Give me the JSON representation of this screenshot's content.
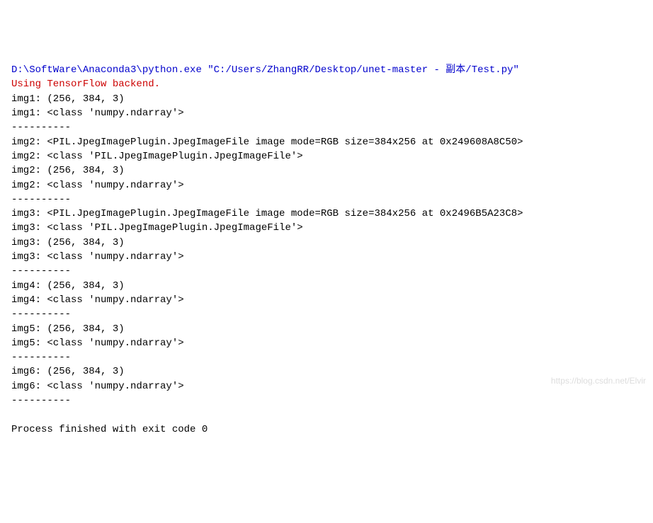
{
  "console": {
    "command": "D:\\SoftWare\\Anaconda3\\python.exe \"C:/Users/ZhangRR/Desktop/unet-master - 副本/Test.py\"",
    "warning": "Using TensorFlow backend.",
    "lines": [
      "img1: (256, 384, 3)",
      "img1: <class 'numpy.ndarray'>",
      "----------",
      "img2: <PIL.JpegImagePlugin.JpegImageFile image mode=RGB size=384x256 at 0x249608A8C50>",
      "img2: <class 'PIL.JpegImagePlugin.JpegImageFile'>",
      "img2: (256, 384, 3)",
      "img2: <class 'numpy.ndarray'>",
      "----------",
      "img3: <PIL.JpegImagePlugin.JpegImageFile image mode=RGB size=384x256 at 0x2496B5A23C8>",
      "img3: <class 'PIL.JpegImagePlugin.JpegImageFile'>",
      "img3: (256, 384, 3)",
      "img3: <class 'numpy.ndarray'>",
      "----------",
      "img4: (256, 384, 3)",
      "img4: <class 'numpy.ndarray'>",
      "----------",
      "img5: (256, 384, 3)",
      "img5: <class 'numpy.ndarray'>",
      "----------",
      "img6: (256, 384, 3)",
      "img6: <class 'numpy.ndarray'>",
      "----------",
      "",
      "Process finished with exit code 0"
    ],
    "watermark": "https://blog.csdn.net/Elvir"
  }
}
